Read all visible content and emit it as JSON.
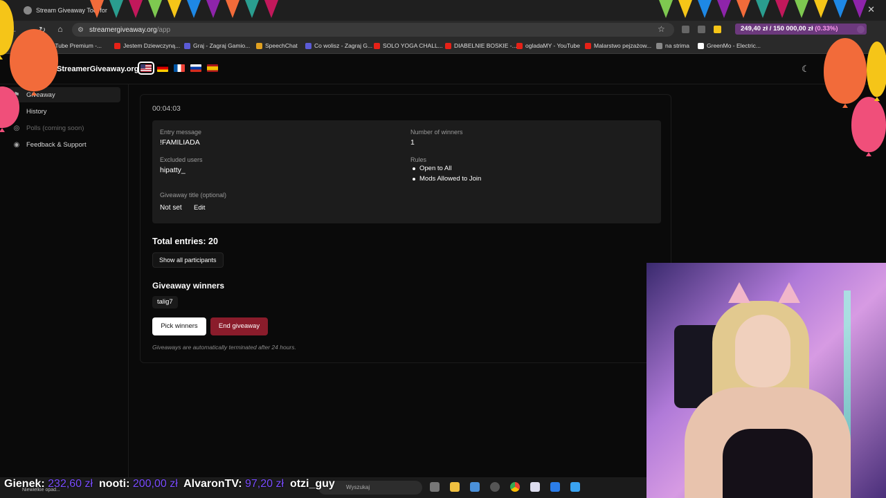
{
  "browser": {
    "tab_title": "Stream Giveaway Tool for",
    "url_host": "streamergiveaway.org",
    "url_path": "/app",
    "donation_overlay": {
      "current": "249,40 zł",
      "goal": "150 000,00 zł",
      "percent": "(0.33%)"
    },
    "bookmarks": [
      {
        "label": "YouTube Premium -...",
        "color": "#e62117"
      },
      {
        "label": "Jestem Dziewczyną...",
        "color": "#e62117"
      },
      {
        "label": "Graj - Zagraj Gamio...",
        "color": "#5b5bd6"
      },
      {
        "label": "SpeechChat",
        "color": "#e0a020"
      },
      {
        "label": "Co wolisz - Zagraj G...",
        "color": "#5b5bd6"
      },
      {
        "label": "SOLO YOGA CHALL...",
        "color": "#e62117"
      },
      {
        "label": "DIABELNIE BOSKIE -...",
        "color": "#e62117"
      },
      {
        "label": "ogladaMY - YouTube",
        "color": "#e62117"
      },
      {
        "label": "Malarstwo pejzażow...",
        "color": "#e62117"
      },
      {
        "label": "na strima",
        "color": "#888888"
      },
      {
        "label": "GreenMo - Electric...",
        "color": "#ffffff"
      }
    ]
  },
  "app": {
    "brand": "StreamerGiveaway.org",
    "languages": [
      "en",
      "de",
      "fr",
      "ru",
      "es"
    ],
    "sidebar": [
      {
        "label": "Giveaway",
        "icon": "gift-icon",
        "state": "active"
      },
      {
        "label": "History",
        "icon": "history-icon",
        "state": "normal"
      },
      {
        "label": "Polls (coming soon)",
        "icon": "poll-icon",
        "state": "disabled"
      },
      {
        "label": "Feedback & Support",
        "icon": "discord-icon",
        "state": "normal"
      }
    ],
    "timer": "00:04:03",
    "settings": {
      "entry_message_label": "Entry message",
      "entry_message": "!FAMILIADA",
      "winners_count_label": "Number of winners",
      "winners_count": "1",
      "excluded_label": "Excluded users",
      "excluded": "hipatty_",
      "rules_label": "Rules",
      "rules": [
        "Open to All",
        "Mods Allowed to Join"
      ],
      "title_label": "Giveaway title (optional)",
      "title_value": "Not set",
      "edit_label": "Edit"
    },
    "total_entries": "Total entries: 20",
    "show_participants": "Show all participants",
    "winners_title": "Giveaway winners",
    "winners": [
      "talig7"
    ],
    "pick_button": "Pick winners",
    "end_button": "End giveaway",
    "note": "Giveaways are automatically terminated after 24 hours."
  },
  "overlay": {
    "ticker": [
      {
        "name": "Gienek:",
        "amount": "232,60 zł"
      },
      {
        "name": "nooti:",
        "amount": "200,00 zł"
      },
      {
        "name": "AlvaronTV:",
        "amount": "97,20 zł"
      },
      {
        "name": "otzi_guy",
        "amount": ""
      }
    ],
    "weather": "Niewielkie opad...",
    "search_placeholder": "Wyszukaj"
  },
  "colors": {
    "end_button": "#8a1c2b",
    "ticker_amount": "#7a4dff",
    "bg": "#0a0a0a"
  }
}
